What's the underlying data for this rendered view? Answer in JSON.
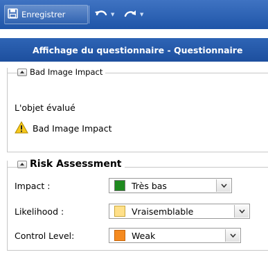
{
  "toolbar": {
    "save_label": "Enregistrer",
    "save_icon": "floppy-disk-icon",
    "undo_icon": "undo-arrow-icon",
    "redo_icon": "redo-arrow-icon"
  },
  "page_title": "Affichage du questionnaire - Questionnaire",
  "sections": {
    "object": {
      "title": "Bad Image Impact",
      "label": "L'objet évalué",
      "object_name": "Bad Image Impact",
      "object_icon": "warning-icon"
    },
    "risk": {
      "title": "Risk Assessment",
      "fields": [
        {
          "label": "Impact :",
          "value": "Très bas",
          "color": "#1f8a1f"
        },
        {
          "label": "Likelihood :",
          "value": "Vraisemblable",
          "color": "#ffe08a"
        },
        {
          "label": "Control Level:",
          "value": "Weak",
          "color": "#f58a1f"
        }
      ]
    }
  }
}
